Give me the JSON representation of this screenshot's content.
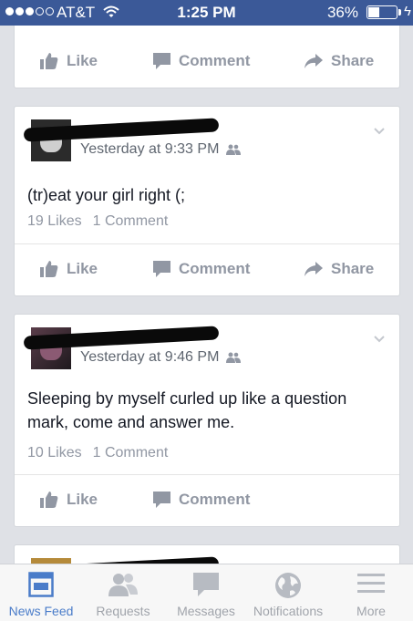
{
  "status_bar": {
    "carrier": "AT&T",
    "time": "1:25 PM",
    "battery": "36%"
  },
  "actions": {
    "like": "Like",
    "comment": "Comment",
    "share": "Share"
  },
  "posts": [
    {
      "timestamp": "Yesterday at 9:33 PM",
      "text": "(tr)eat your girl right (;",
      "likes": "19 Likes",
      "comments": "1 Comment"
    },
    {
      "timestamp": "Yesterday at 9:46 PM",
      "text": "Sleeping by myself curled up like a question mark, come and answer me.",
      "likes": "10 Likes",
      "comments": "1 Comment"
    }
  ],
  "tabs": [
    {
      "label": "News Feed",
      "icon": "news-feed-icon",
      "active": true
    },
    {
      "label": "Requests",
      "icon": "requests-icon",
      "active": false
    },
    {
      "label": "Messages",
      "icon": "messages-icon",
      "active": false
    },
    {
      "label": "Notifications",
      "icon": "globe-icon",
      "active": false
    },
    {
      "label": "More",
      "icon": "menu-icon",
      "active": false
    }
  ],
  "colors": {
    "brand": "#3b5998",
    "muted": "#9197a3",
    "active_tab": "#4a7cc9"
  }
}
